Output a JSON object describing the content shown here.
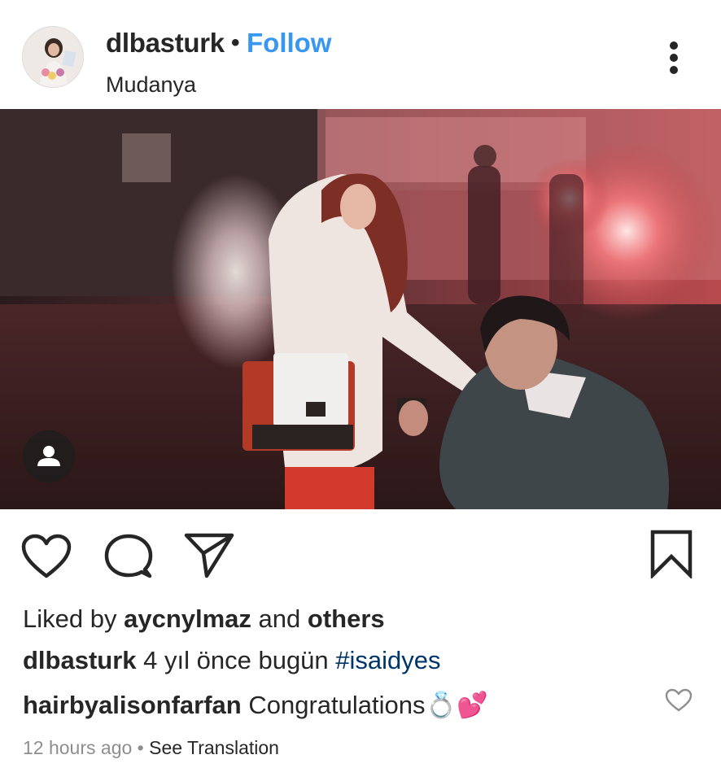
{
  "post": {
    "username": "dlbasturk",
    "separator": "•",
    "follow_label": "Follow",
    "location": "Mudanya"
  },
  "icons": {
    "more": "more-options-icon",
    "like": "heart-icon",
    "comment": "comment-bubble-icon",
    "share": "paper-plane-icon",
    "save": "bookmark-icon",
    "user_tag": "person-icon",
    "comment_like": "small-heart-icon"
  },
  "likes": {
    "prefix": "Liked by",
    "user": "aycnylmaz",
    "conjunction": "and",
    "others": "others"
  },
  "caption": {
    "username": "dlbasturk",
    "text": "4 yıl önce bugün",
    "hashtag": "#isaidyes"
  },
  "comment": {
    "username": "hairbyalisonfarfan",
    "text": "Congratulations",
    "emoji": "💍💕"
  },
  "meta": {
    "time": "12 hours ago",
    "separator": "•",
    "translate_label": "See Translation"
  },
  "colors": {
    "follow": "#3897f0",
    "hashtag": "#003569",
    "text": "#262626",
    "muted": "#8e8e8e"
  }
}
